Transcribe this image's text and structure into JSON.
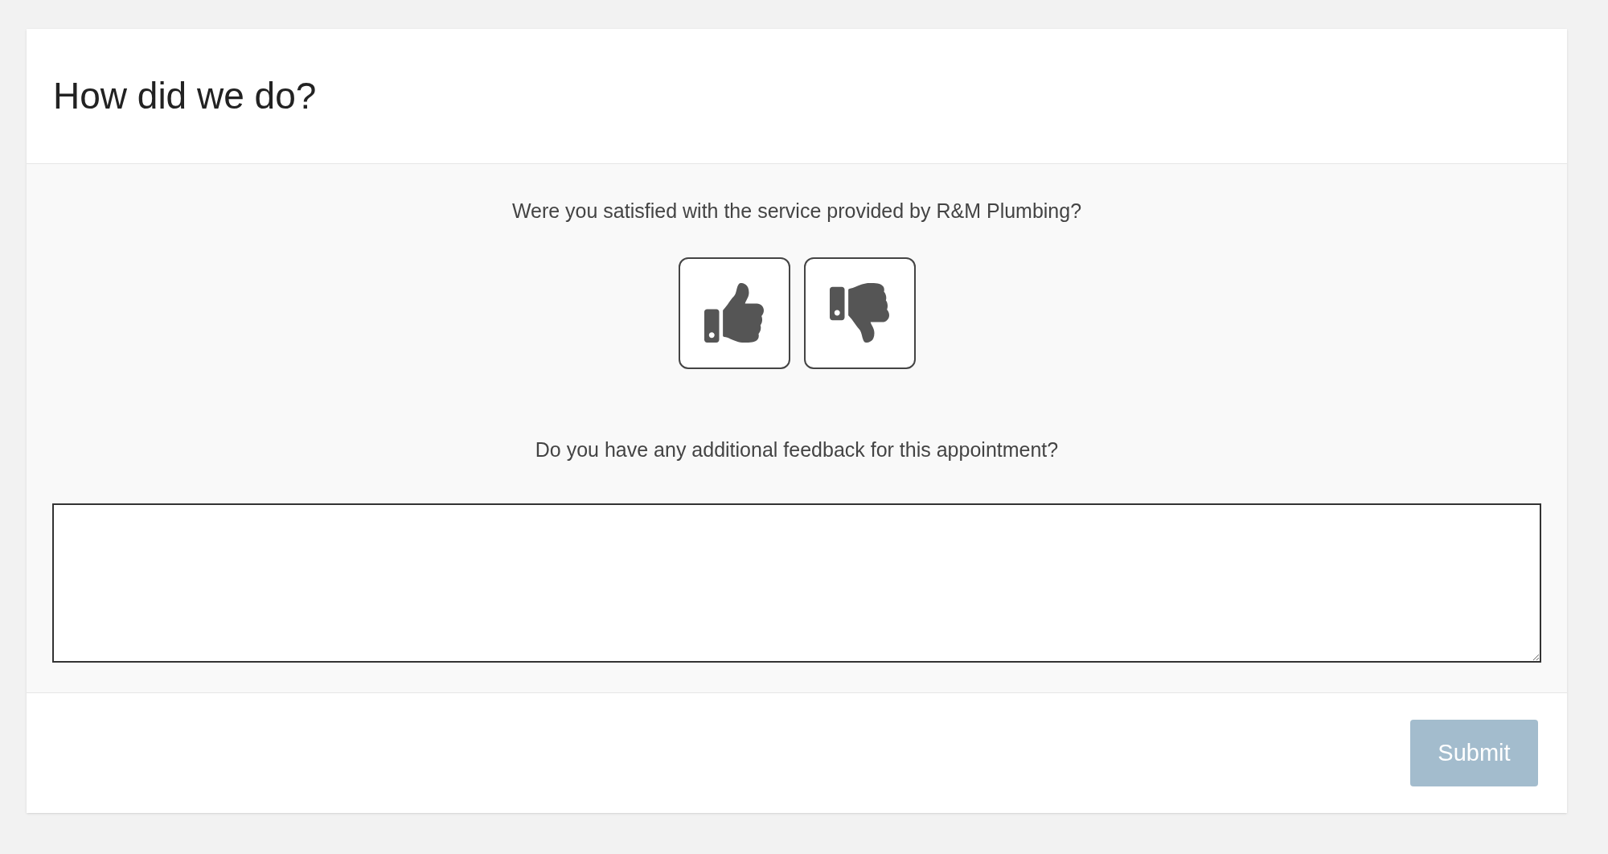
{
  "title": "How did we do?",
  "satisfaction": {
    "question": "Were you satisfied with the service provided by R&M Plumbing?",
    "options": [
      {
        "kind": "up",
        "selected": false
      },
      {
        "kind": "down",
        "selected": false
      }
    ]
  },
  "feedback": {
    "question": "Do you have any additional feedback for this appointment?"
  },
  "submit": {
    "label": "Submit",
    "disabled": true
  }
}
